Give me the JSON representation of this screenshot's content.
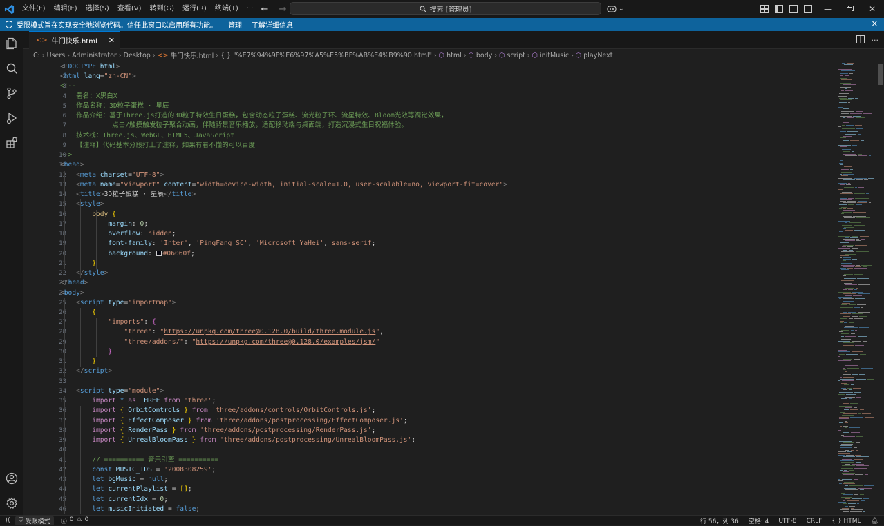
{
  "menu": [
    "文件(F)",
    "编辑(E)",
    "选择(S)",
    "查看(V)",
    "转到(G)",
    "运行(R)",
    "终端(T)",
    "···"
  ],
  "search": {
    "placeholder": "搜索 [管理员]"
  },
  "banner": {
    "text": "受限模式旨在实现安全地浏览代码。信任此窗口以启用所有功能。",
    "manage": "管理",
    "learn_more": "了解详细信息"
  },
  "tab": {
    "title": "牛门快乐.html"
  },
  "breadcrumb": [
    "C:",
    "Users",
    "Administrator",
    "Desktop",
    "牛门快乐.html",
    "\"%E7%94%9F%E6%97%A5%E5%BF%AB%E4%B9%90.html\"",
    "html",
    "body",
    "script",
    "initMusic",
    "playNext"
  ],
  "code_lines": [
    [
      {
        "c": "t-punct",
        "t": "<!"
      },
      {
        "c": "t-tag",
        "t": "DOCTYPE"
      },
      {
        "c": "t-text",
        "t": " "
      },
      {
        "c": "t-attr",
        "t": "html"
      },
      {
        "c": "t-punct",
        "t": ">"
      }
    ],
    [
      {
        "c": "t-punct",
        "t": "<"
      },
      {
        "c": "t-tag",
        "t": "html"
      },
      {
        "c": "t-text",
        "t": " "
      },
      {
        "c": "t-attr",
        "t": "lang"
      },
      {
        "c": "t-text",
        "t": "="
      },
      {
        "c": "t-str",
        "t": "\"zh-CN\""
      },
      {
        "c": "t-punct",
        "t": ">"
      }
    ],
    [
      {
        "c": "t-cmt",
        "t": "<!--"
      }
    ],
    [
      {
        "c": "t-cmt",
        "t": "    署名：X黑白X"
      }
    ],
    [
      {
        "c": "t-cmt",
        "t": "    作品名称：3D粒子蛋糕 · 星辰"
      }
    ],
    [
      {
        "c": "t-cmt",
        "t": "    作品介绍：基于Three.js打造的3D粒子特效生日蛋糕，包含动态粒子蛋糕、流光粒子环、流星特效、Bloom光效等视觉效果，"
      }
    ],
    [
      {
        "c": "t-cmt",
        "t": "             点击/触摸触发粒子聚合动画，伴随背景音乐播放，适配移动端与桌面端，打造沉浸式生日祝福体验。"
      }
    ],
    [
      {
        "c": "t-cmt",
        "t": "    技术栈：Three.js、WebGL、HTML5、JavaScript"
      }
    ],
    [
      {
        "c": "t-cmt",
        "t": "    【注释】代码基本分段打上了注释，如果有看不懂的可以百度"
      }
    ],
    [
      {
        "c": "t-cmt",
        "t": "-->"
      }
    ],
    [
      {
        "c": "t-punct",
        "t": "<"
      },
      {
        "c": "t-tag",
        "t": "head"
      },
      {
        "c": "t-punct",
        "t": ">"
      }
    ],
    [
      {
        "c": "t-text",
        "t": "    "
      },
      {
        "c": "t-punct",
        "t": "<"
      },
      {
        "c": "t-tag",
        "t": "meta"
      },
      {
        "c": "t-text",
        "t": " "
      },
      {
        "c": "t-attr",
        "t": "charset"
      },
      {
        "c": "t-text",
        "t": "="
      },
      {
        "c": "t-str",
        "t": "\"UTF-8\""
      },
      {
        "c": "t-punct",
        "t": ">"
      }
    ],
    [
      {
        "c": "t-text",
        "t": "    "
      },
      {
        "c": "t-punct",
        "t": "<"
      },
      {
        "c": "t-tag",
        "t": "meta"
      },
      {
        "c": "t-text",
        "t": " "
      },
      {
        "c": "t-attr",
        "t": "name"
      },
      {
        "c": "t-text",
        "t": "="
      },
      {
        "c": "t-str",
        "t": "\"viewport\""
      },
      {
        "c": "t-text",
        "t": " "
      },
      {
        "c": "t-attr",
        "t": "content"
      },
      {
        "c": "t-text",
        "t": "="
      },
      {
        "c": "t-str",
        "t": "\"width=device-width, initial-scale=1.0, user-scalable=no, viewport-fit=cover\""
      },
      {
        "c": "t-punct",
        "t": ">"
      }
    ],
    [
      {
        "c": "t-text",
        "t": "    "
      },
      {
        "c": "t-punct",
        "t": "<"
      },
      {
        "c": "t-tag",
        "t": "title"
      },
      {
        "c": "t-punct",
        "t": ">"
      },
      {
        "c": "t-text",
        "t": "3D粒子蛋糕 · 星辰"
      },
      {
        "c": "t-punct",
        "t": "</"
      },
      {
        "c": "t-tag",
        "t": "title"
      },
      {
        "c": "t-punct",
        "t": ">"
      }
    ],
    [
      {
        "c": "t-text",
        "t": "    "
      },
      {
        "c": "t-punct",
        "t": "<"
      },
      {
        "c": "t-tag",
        "t": "style"
      },
      {
        "c": "t-punct",
        "t": ">"
      }
    ],
    [
      {
        "c": "t-text",
        "t": "        "
      },
      {
        "c": "t-sel",
        "t": "body"
      },
      {
        "c": "t-text",
        "t": " "
      },
      {
        "c": "t-br",
        "t": "{"
      }
    ],
    [
      {
        "c": "t-text",
        "t": "            "
      },
      {
        "c": "t-prop",
        "t": "margin"
      },
      {
        "c": "t-text",
        "t": ": "
      },
      {
        "c": "t-num",
        "t": "0"
      },
      {
        "c": "t-text",
        "t": ";"
      }
    ],
    [
      {
        "c": "t-text",
        "t": "            "
      },
      {
        "c": "t-prop",
        "t": "overflow"
      },
      {
        "c": "t-text",
        "t": ": "
      },
      {
        "c": "t-val",
        "t": "hidden"
      },
      {
        "c": "t-text",
        "t": ";"
      }
    ],
    [
      {
        "c": "t-text",
        "t": "            "
      },
      {
        "c": "t-prop",
        "t": "font-family"
      },
      {
        "c": "t-text",
        "t": ": "
      },
      {
        "c": "t-val",
        "t": "'Inter'"
      },
      {
        "c": "t-text",
        "t": ", "
      },
      {
        "c": "t-val",
        "t": "'PingFang SC'"
      },
      {
        "c": "t-text",
        "t": ", "
      },
      {
        "c": "t-val",
        "t": "'Microsoft YaHei'"
      },
      {
        "c": "t-text",
        "t": ", "
      },
      {
        "c": "t-val",
        "t": "sans-serif"
      },
      {
        "c": "t-text",
        "t": ";"
      }
    ],
    [
      {
        "c": "t-text",
        "t": "            "
      },
      {
        "c": "t-prop",
        "t": "background"
      },
      {
        "c": "t-text",
        "t": ": "
      },
      {
        "c": "t-swatch",
        "t": ""
      },
      {
        "c": "t-val",
        "t": "#06060f"
      },
      {
        "c": "t-text",
        "t": ";"
      }
    ],
    [
      {
        "c": "t-text",
        "t": "        "
      },
      {
        "c": "t-br",
        "t": "}"
      }
    ],
    [
      {
        "c": "t-text",
        "t": "    "
      },
      {
        "c": "t-punct",
        "t": "</"
      },
      {
        "c": "t-tag",
        "t": "style"
      },
      {
        "c": "t-punct",
        "t": ">"
      }
    ],
    [
      {
        "c": "t-punct",
        "t": "</"
      },
      {
        "c": "t-tag",
        "t": "head"
      },
      {
        "c": "t-punct",
        "t": ">"
      }
    ],
    [
      {
        "c": "t-punct",
        "t": "<"
      },
      {
        "c": "t-tag",
        "t": "body"
      },
      {
        "c": "t-punct",
        "t": ">"
      }
    ],
    [
      {
        "c": "t-text",
        "t": "    "
      },
      {
        "c": "t-punct",
        "t": "<"
      },
      {
        "c": "t-tag",
        "t": "script"
      },
      {
        "c": "t-text",
        "t": " "
      },
      {
        "c": "t-attr",
        "t": "type"
      },
      {
        "c": "t-text",
        "t": "="
      },
      {
        "c": "t-str",
        "t": "\"importmap\""
      },
      {
        "c": "t-punct",
        "t": ">"
      }
    ],
    [
      {
        "c": "t-text",
        "t": "        "
      },
      {
        "c": "t-br",
        "t": "{"
      }
    ],
    [
      {
        "c": "t-text",
        "t": "            "
      },
      {
        "c": "t-str",
        "t": "\"imports\""
      },
      {
        "c": "t-text",
        "t": ": "
      },
      {
        "c": "t-br2",
        "t": "{"
      }
    ],
    [
      {
        "c": "t-text",
        "t": "                "
      },
      {
        "c": "t-str",
        "t": "\"three\""
      },
      {
        "c": "t-text",
        "t": ": "
      },
      {
        "c": "t-str",
        "t": "\""
      },
      {
        "c": "t-link",
        "t": "https://unpkg.com/three@0.128.0/build/three.module.js"
      },
      {
        "c": "t-str",
        "t": "\""
      },
      {
        "c": "t-text",
        "t": ","
      }
    ],
    [
      {
        "c": "t-text",
        "t": "                "
      },
      {
        "c": "t-str",
        "t": "\"three/addons/\""
      },
      {
        "c": "t-text",
        "t": ": "
      },
      {
        "c": "t-str",
        "t": "\""
      },
      {
        "c": "t-link",
        "t": "https://unpkg.com/three@0.128.0/examples/jsm/"
      },
      {
        "c": "t-str",
        "t": "\""
      }
    ],
    [
      {
        "c": "t-text",
        "t": "            "
      },
      {
        "c": "t-br2",
        "t": "}"
      }
    ],
    [
      {
        "c": "t-text",
        "t": "        "
      },
      {
        "c": "t-br",
        "t": "}"
      }
    ],
    [
      {
        "c": "t-text",
        "t": "    "
      },
      {
        "c": "t-punct",
        "t": "</"
      },
      {
        "c": "t-tag",
        "t": "script"
      },
      {
        "c": "t-punct",
        "t": ">"
      }
    ],
    [],
    [
      {
        "c": "t-text",
        "t": "    "
      },
      {
        "c": "t-punct",
        "t": "<"
      },
      {
        "c": "t-tag",
        "t": "script"
      },
      {
        "c": "t-text",
        "t": " "
      },
      {
        "c": "t-attr",
        "t": "type"
      },
      {
        "c": "t-text",
        "t": "="
      },
      {
        "c": "t-str",
        "t": "\"module\""
      },
      {
        "c": "t-punct",
        "t": ">"
      }
    ],
    [
      {
        "c": "t-text",
        "t": "        "
      },
      {
        "c": "t-ctl",
        "t": "import"
      },
      {
        "c": "t-text",
        "t": " "
      },
      {
        "c": "t-kw",
        "t": "*"
      },
      {
        "c": "t-text",
        "t": " "
      },
      {
        "c": "t-ctl",
        "t": "as"
      },
      {
        "c": "t-text",
        "t": " "
      },
      {
        "c": "t-var",
        "t": "THREE"
      },
      {
        "c": "t-text",
        "t": " "
      },
      {
        "c": "t-ctl",
        "t": "from"
      },
      {
        "c": "t-text",
        "t": " "
      },
      {
        "c": "t-str",
        "t": "'three'"
      },
      {
        "c": "t-text",
        "t": ";"
      }
    ],
    [
      {
        "c": "t-text",
        "t": "        "
      },
      {
        "c": "t-ctl",
        "t": "import"
      },
      {
        "c": "t-text",
        "t": " "
      },
      {
        "c": "t-br",
        "t": "{"
      },
      {
        "c": "t-text",
        "t": " "
      },
      {
        "c": "t-var",
        "t": "OrbitControls"
      },
      {
        "c": "t-text",
        "t": " "
      },
      {
        "c": "t-br",
        "t": "}"
      },
      {
        "c": "t-text",
        "t": " "
      },
      {
        "c": "t-ctl",
        "t": "from"
      },
      {
        "c": "t-text",
        "t": " "
      },
      {
        "c": "t-str",
        "t": "'three/addons/controls/OrbitControls.js'"
      },
      {
        "c": "t-text",
        "t": ";"
      }
    ],
    [
      {
        "c": "t-text",
        "t": "        "
      },
      {
        "c": "t-ctl",
        "t": "import"
      },
      {
        "c": "t-text",
        "t": " "
      },
      {
        "c": "t-br",
        "t": "{"
      },
      {
        "c": "t-text",
        "t": " "
      },
      {
        "c": "t-var",
        "t": "EffectComposer"
      },
      {
        "c": "t-text",
        "t": " "
      },
      {
        "c": "t-br",
        "t": "}"
      },
      {
        "c": "t-text",
        "t": " "
      },
      {
        "c": "t-ctl",
        "t": "from"
      },
      {
        "c": "t-text",
        "t": " "
      },
      {
        "c": "t-str",
        "t": "'three/addons/postprocessing/EffectComposer.js'"
      },
      {
        "c": "t-text",
        "t": ";"
      }
    ],
    [
      {
        "c": "t-text",
        "t": "        "
      },
      {
        "c": "t-ctl",
        "t": "import"
      },
      {
        "c": "t-text",
        "t": " "
      },
      {
        "c": "t-br",
        "t": "{"
      },
      {
        "c": "t-text",
        "t": " "
      },
      {
        "c": "t-var",
        "t": "RenderPass"
      },
      {
        "c": "t-text",
        "t": " "
      },
      {
        "c": "t-br",
        "t": "}"
      },
      {
        "c": "t-text",
        "t": " "
      },
      {
        "c": "t-ctl",
        "t": "from"
      },
      {
        "c": "t-text",
        "t": " "
      },
      {
        "c": "t-str",
        "t": "'three/addons/postprocessing/RenderPass.js'"
      },
      {
        "c": "t-text",
        "t": ";"
      }
    ],
    [
      {
        "c": "t-text",
        "t": "        "
      },
      {
        "c": "t-ctl",
        "t": "import"
      },
      {
        "c": "t-text",
        "t": " "
      },
      {
        "c": "t-br",
        "t": "{"
      },
      {
        "c": "t-text",
        "t": " "
      },
      {
        "c": "t-var",
        "t": "UnrealBloomPass"
      },
      {
        "c": "t-text",
        "t": " "
      },
      {
        "c": "t-br",
        "t": "}"
      },
      {
        "c": "t-text",
        "t": " "
      },
      {
        "c": "t-ctl",
        "t": "from"
      },
      {
        "c": "t-text",
        "t": " "
      },
      {
        "c": "t-str",
        "t": "'three/addons/postprocessing/UnrealBloomPass.js'"
      },
      {
        "c": "t-text",
        "t": ";"
      }
    ],
    [],
    [
      {
        "c": "t-text",
        "t": "        "
      },
      {
        "c": "t-cmt",
        "t": "// ========== 音乐引擎 =========="
      }
    ],
    [
      {
        "c": "t-text",
        "t": "        "
      },
      {
        "c": "t-kw",
        "t": "const"
      },
      {
        "c": "t-text",
        "t": " "
      },
      {
        "c": "t-var",
        "t": "MUSIC_IDS"
      },
      {
        "c": "t-text",
        "t": " = "
      },
      {
        "c": "t-str",
        "t": "'2008308259'"
      },
      {
        "c": "t-text",
        "t": ";"
      }
    ],
    [
      {
        "c": "t-text",
        "t": "        "
      },
      {
        "c": "t-kw",
        "t": "let"
      },
      {
        "c": "t-text",
        "t": " "
      },
      {
        "c": "t-var",
        "t": "bgMusic"
      },
      {
        "c": "t-text",
        "t": " = "
      },
      {
        "c": "t-kw",
        "t": "null"
      },
      {
        "c": "t-text",
        "t": ";"
      }
    ],
    [
      {
        "c": "t-text",
        "t": "        "
      },
      {
        "c": "t-kw",
        "t": "let"
      },
      {
        "c": "t-text",
        "t": " "
      },
      {
        "c": "t-var",
        "t": "currentPlaylist"
      },
      {
        "c": "t-text",
        "t": " = "
      },
      {
        "c": "t-br",
        "t": "[]"
      },
      {
        "c": "t-text",
        "t": ";"
      }
    ],
    [
      {
        "c": "t-text",
        "t": "        "
      },
      {
        "c": "t-kw",
        "t": "let"
      },
      {
        "c": "t-text",
        "t": " "
      },
      {
        "c": "t-var",
        "t": "currentIdx"
      },
      {
        "c": "t-text",
        "t": " = "
      },
      {
        "c": "t-num",
        "t": "0"
      },
      {
        "c": "t-text",
        "t": ";"
      }
    ],
    [
      {
        "c": "t-text",
        "t": "        "
      },
      {
        "c": "t-kw",
        "t": "let"
      },
      {
        "c": "t-text",
        "t": " "
      },
      {
        "c": "t-var",
        "t": "musicInitiated"
      },
      {
        "c": "t-text",
        "t": " = "
      },
      {
        "c": "t-kw",
        "t": "false"
      },
      {
        "c": "t-text",
        "t": ";"
      }
    ]
  ],
  "line_count": 46,
  "status": {
    "restricted": "受限模式",
    "errors": "0",
    "warnings": "0",
    "position": "行 56，列 36",
    "spaces": "空格: 4",
    "encoding": "UTF-8",
    "eol": "CRLF",
    "language": "HTML"
  },
  "colors": {
    "accent": "#0078d4",
    "banner": "#0e639c"
  }
}
